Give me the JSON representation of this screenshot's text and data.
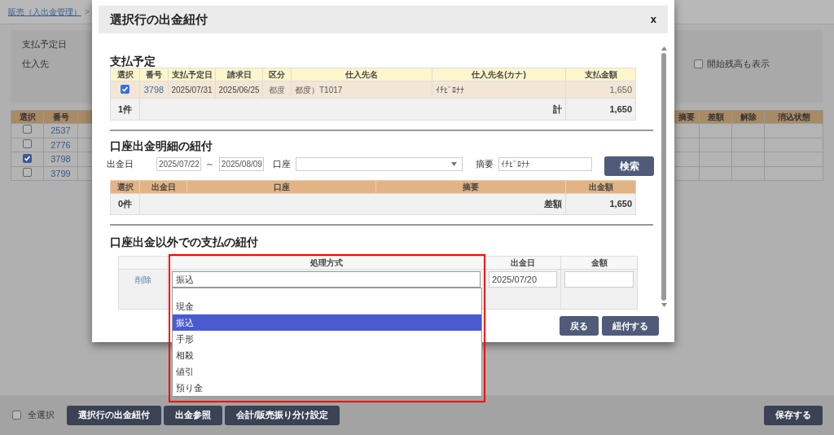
{
  "breadcrumb": {
    "link": "販売（入出金管理）",
    "separator": ">"
  },
  "filter": {
    "labels": [
      "支払予定日",
      "仕入先"
    ],
    "opening_balance": {
      "label": "開始残高も表示",
      "checked": false
    }
  },
  "list_table": {
    "columns": [
      "選択",
      "番号",
      "摘要",
      "差額",
      "解除",
      "消込状態"
    ],
    "rows": [
      {
        "checked": false,
        "number": "2537"
      },
      {
        "checked": false,
        "number": "2776"
      },
      {
        "checked": true,
        "number": "3798"
      },
      {
        "checked": false,
        "number": "3799"
      }
    ]
  },
  "footer": {
    "select_all": {
      "label": "全選択",
      "checked": false
    },
    "buttons": [
      "選択行の出金紐付",
      "出金参照",
      "会計/販売振り分け設定"
    ],
    "save_button": "保存する"
  },
  "dialog": {
    "title": "選択行の出金紐付",
    "close": "x",
    "schedule": {
      "heading": "支払予定",
      "columns": [
        "選択",
        "番号",
        "支払予定日",
        "請求日",
        "区分",
        "仕入先名",
        "仕入先名(カナ)",
        "支払金額"
      ],
      "rows": [
        {
          "checked": true,
          "number": "3798",
          "due_date": "2025/07/31",
          "invoice_date": "2025/06/25",
          "category": "都度",
          "supplier": "都度）T1017",
          "supplier_kana": "ｲﾁﾋﾞﾛﾅﾅ",
          "amount": "1,650"
        }
      ],
      "count": "1件",
      "total_label": "計",
      "total": "1,650"
    },
    "bank": {
      "heading": "口座出金明細の紐付",
      "date_label": "出金日",
      "date_from": "2025/07/22",
      "range_separator": "～",
      "date_to": "2025/08/09",
      "account_label": "口座",
      "summary_label": "摘要",
      "summary_value": "ｲﾁﾋﾞﾛﾅﾅ",
      "search_button": "検索",
      "columns": [
        "選択",
        "出金日",
        "口座",
        "摘要",
        "出金額"
      ],
      "count": "0件",
      "difference_label": "差額",
      "difference": "1,650"
    },
    "other": {
      "heading": "口座出金以外での支払の紐付",
      "columns": [
        "処理方式",
        "出金日",
        "金額"
      ],
      "rows": [
        {
          "delete": "削除",
          "method": "振込",
          "date": "2025/07/20"
        }
      ],
      "options": [
        {
          "label": "現金",
          "selected": false
        },
        {
          "label": "振込",
          "selected": true
        },
        {
          "label": "手形",
          "selected": false
        },
        {
          "label": "相殺",
          "selected": false
        },
        {
          "label": "値引",
          "selected": false
        },
        {
          "label": "預り金",
          "selected": false
        }
      ]
    },
    "buttons": [
      "戻る",
      "紐付する"
    ]
  }
}
